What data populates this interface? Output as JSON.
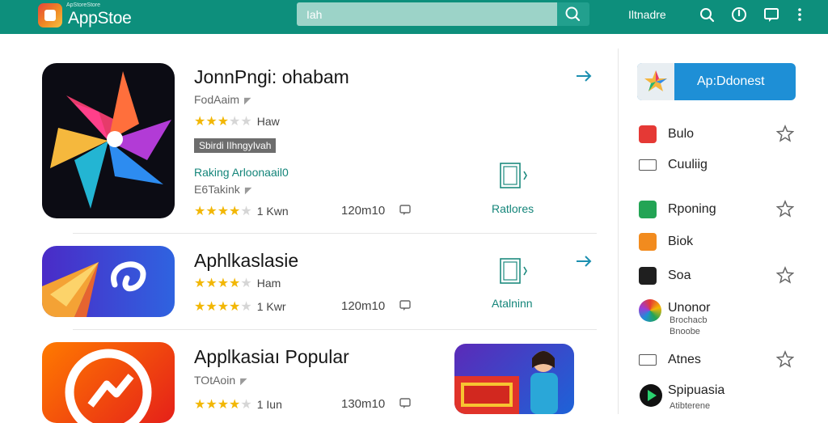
{
  "header": {
    "logo_tiny": "ApStoreStore",
    "logo_text": "AppStoe",
    "search_value": "Iah",
    "right_text": "Iltnadre",
    "icons": [
      "search-icon",
      "alert-icon",
      "message-icon",
      "more-icon"
    ]
  },
  "apps": [
    {
      "title": "JonnPngi: ohabam",
      "developer": "FodAaim",
      "stars_label": "Haw",
      "tag": "Sbirdi IIhngyIvah",
      "ranking_label": "Raking Arloonaail0",
      "sub_developer": "E6Takink",
      "stars2_label": "1 Kwn",
      "size": "120m10",
      "action_label": "Ratlores"
    },
    {
      "title": "Aphlkaslasie",
      "stars_label": "Ham",
      "stars2_label": "1 Kwr",
      "size": "120m10",
      "action_label": "Atalninn"
    },
    {
      "title": "Applkasiaı Popular",
      "developer": "TOtAoin",
      "stars_label": "1 Iun",
      "size": "130m10"
    }
  ],
  "sidebar": {
    "cta_label": "Ap:Ddonest",
    "items": [
      {
        "label": "Bulo",
        "icon": "red-app-icon"
      },
      {
        "label": "Cuuliig",
        "icon": "grid-icon"
      },
      {
        "label": "Rponing",
        "icon": "green-app-icon"
      },
      {
        "label": "Biok",
        "icon": "orange-app-icon"
      },
      {
        "label": "Soa",
        "icon": "dark-app-icon"
      },
      {
        "label": "Unonor",
        "sub1": "Brochacb",
        "sub2": "Bnoobe",
        "icon": "colorful-app-icon"
      },
      {
        "label": "Atnes",
        "icon": "box-icon"
      },
      {
        "label": "Spipuasia",
        "sub1": "Atibterene",
        "icon": "play-icon"
      }
    ]
  },
  "colors": {
    "header": "#0d8f7c",
    "accent": "#14857a",
    "cta": "#1e8fd6",
    "star": "#f2b705"
  }
}
